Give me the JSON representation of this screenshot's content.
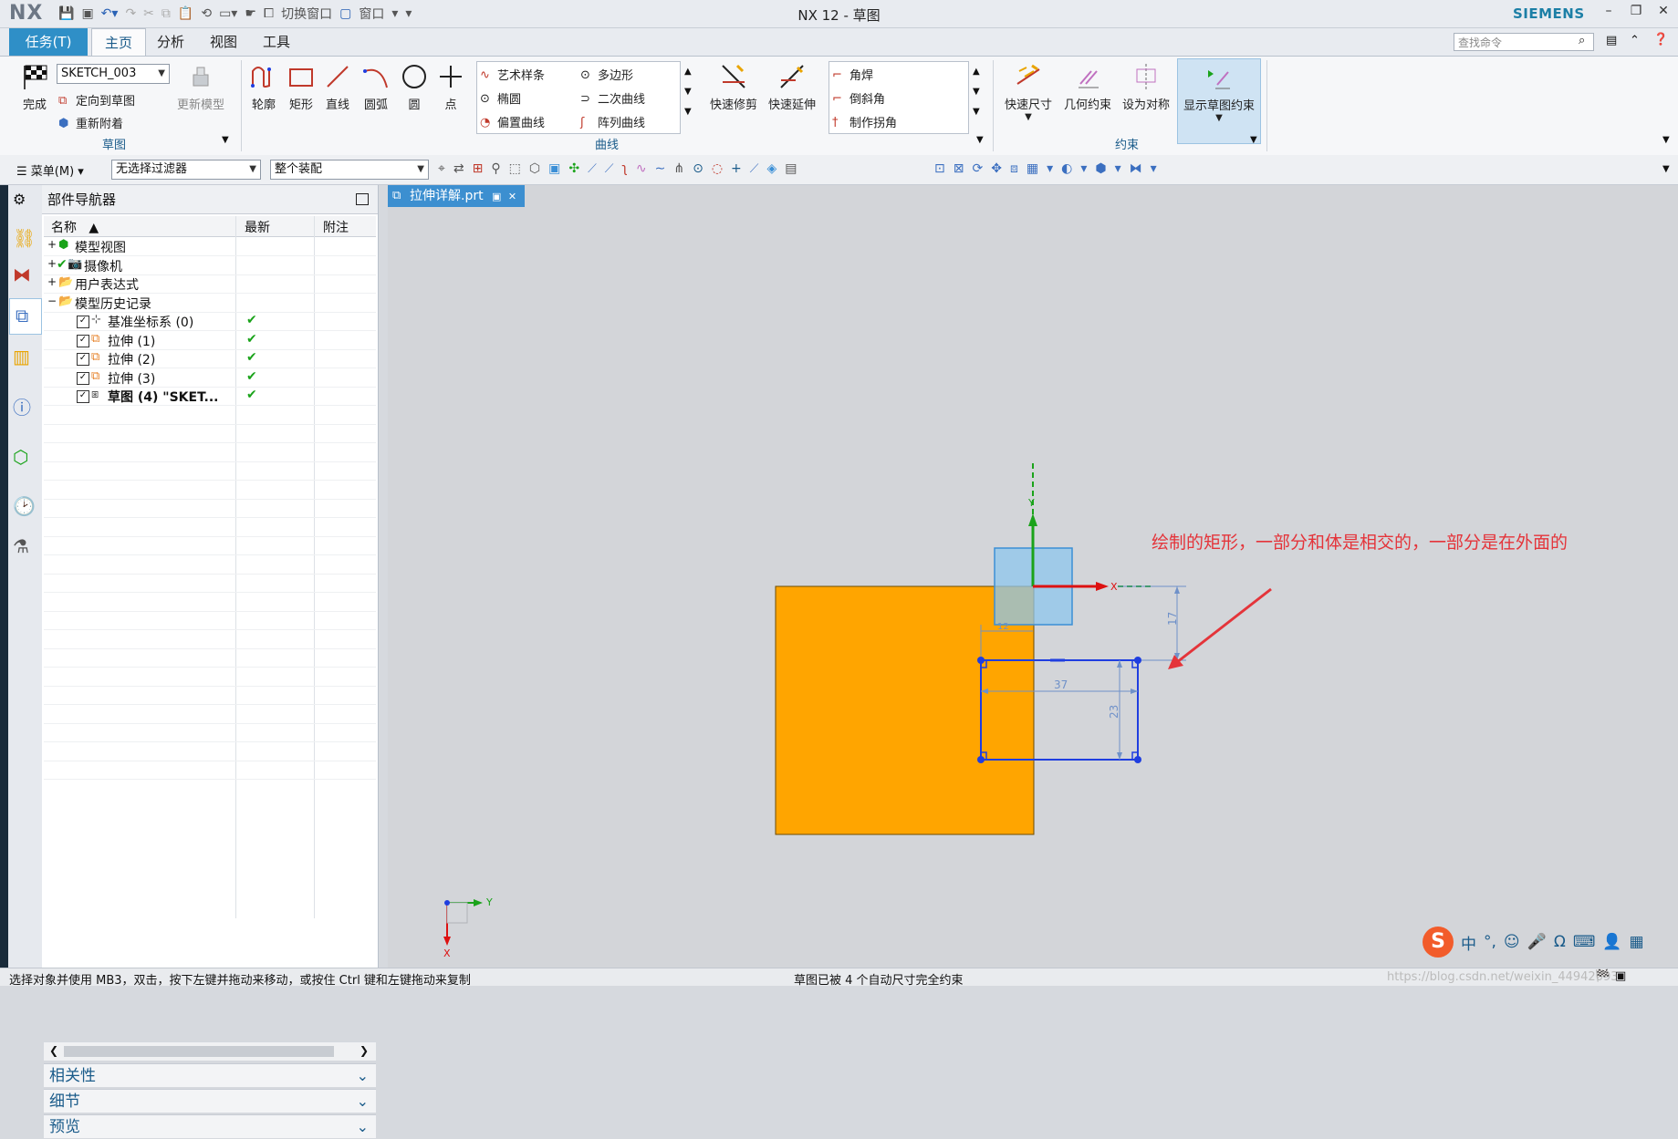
{
  "titlebar": {
    "logo": "NX",
    "switch_window": "切换窗口",
    "window_menu": "窗口",
    "title": "NX 12 - 草图",
    "brand": "SIEMENS"
  },
  "tabs": {
    "task": "任务(T)",
    "items": [
      "主页",
      "分析",
      "视图",
      "工具"
    ],
    "active": "主页",
    "search_placeholder": "查找命令"
  },
  "ribbon": {
    "sketch_group": {
      "finish": "完成",
      "sketch_name": "SKETCH_003",
      "orient": "定向到草图",
      "reattach": "重新附着",
      "update_model": "更新模型",
      "label": "草图"
    },
    "curve_group": {
      "big": [
        "轮廓",
        "矩形",
        "直线",
        "圆弧",
        "圆",
        "点"
      ],
      "col1": [
        "艺术样条",
        "椭圆",
        "偏置曲线"
      ],
      "col2": [
        "多边形",
        "二次曲线",
        "阵列曲线"
      ],
      "trim": "快速修剪",
      "extend": "快速延伸",
      "edit": [
        "角焊",
        "倒斜角",
        "制作拐角"
      ],
      "label": "曲线"
    },
    "constraint_group": {
      "items": [
        "快速尺寸",
        "几何约束",
        "设为对称",
        "显示草图约束"
      ],
      "label": "约束"
    }
  },
  "toolbar2": {
    "menu": "菜单(M)",
    "filter": "无选择过滤器",
    "assembly": "整个装配"
  },
  "navigator": {
    "title": "部件导航器",
    "columns": [
      "名称",
      "最新",
      "附注"
    ],
    "rows": [
      {
        "label": "模型视图",
        "indent": 0,
        "expander": "+",
        "latest": ""
      },
      {
        "label": "摄像机",
        "indent": 0,
        "expander": "+",
        "latest": ""
      },
      {
        "label": "用户表达式",
        "indent": 0,
        "expander": "+",
        "latest": ""
      },
      {
        "label": "模型历史记录",
        "indent": 0,
        "expander": "−",
        "latest": ""
      },
      {
        "label": "基准坐标系 (0)",
        "indent": 1,
        "expander": "",
        "latest": "✔"
      },
      {
        "label": "拉伸 (1)",
        "indent": 1,
        "expander": "",
        "latest": "✔"
      },
      {
        "label": "拉伸 (2)",
        "indent": 1,
        "expander": "",
        "latest": "✔"
      },
      {
        "label": "拉伸 (3)",
        "indent": 1,
        "expander": "",
        "latest": "✔"
      },
      {
        "label": "草图 (4) \"SKET...",
        "indent": 1,
        "expander": "",
        "latest": "✔"
      }
    ],
    "panels": [
      "相关性",
      "细节",
      "预览"
    ]
  },
  "graphics": {
    "doc_tab": "拉伸详解.prt",
    "annotation": "绘制的矩形，一部分和体是相交的，一部分是在外面的",
    "dim_width": "37",
    "dim_height": "23",
    "dim_offset": "17",
    "dim_small": "12",
    "axis_x": "X",
    "axis_y": "Y"
  },
  "ime": {
    "items": [
      "中",
      "°,",
      "☺",
      "🎤",
      "Ω",
      "⌨"
    ]
  },
  "status": {
    "left": "选择对象并使用 MB3，双击，按下左键并拖动来移动，或按住 Ctrl 键和左键拖动来复制",
    "center": "草图已被 4 个自动尺寸完全约束",
    "watermark": "https://blog.csdn.net/weixin_44942093"
  },
  "colors": {
    "accent": "#2f8fc7",
    "body_orange": "#ffa500",
    "sketch_blue": "#1f3ee0",
    "annotation_red": "#e4343a"
  }
}
